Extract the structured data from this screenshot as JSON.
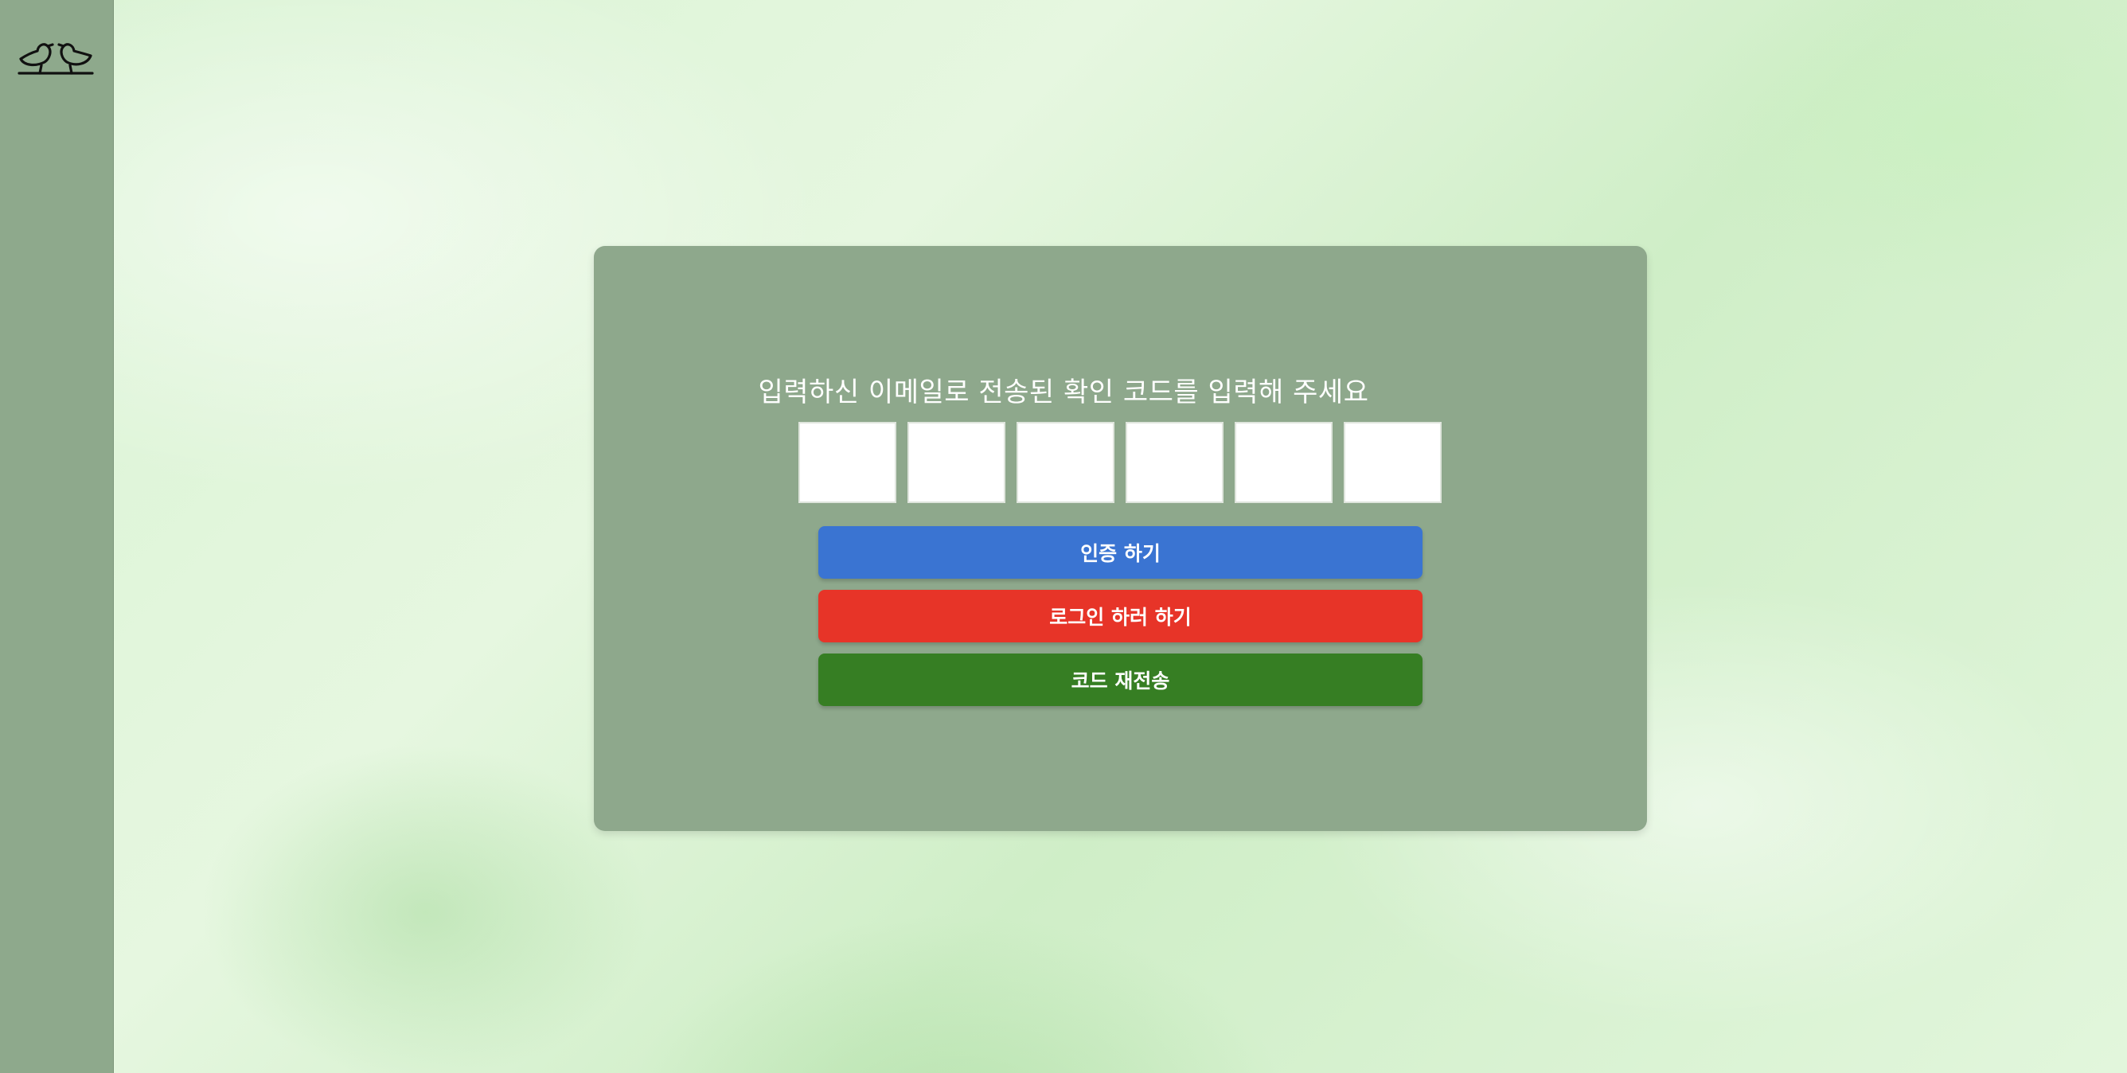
{
  "sidebar": {
    "logo_icon": "two-birds-icon"
  },
  "verify": {
    "prompt": "입력하신 이메일로 전송된 확인 코드를 입력해 주세요",
    "code_boxes": [
      "",
      "",
      "",
      "",
      "",
      ""
    ],
    "verify_label": "인증 하기",
    "login_label": "로그인 하러 하기",
    "resend_label": "코드 재전송"
  },
  "colors": {
    "sidebar": "#8ea98c",
    "card": "#8ea88c",
    "verify_button": "#3a74d2",
    "login_button": "#e73428",
    "resend_button": "#367e23"
  }
}
